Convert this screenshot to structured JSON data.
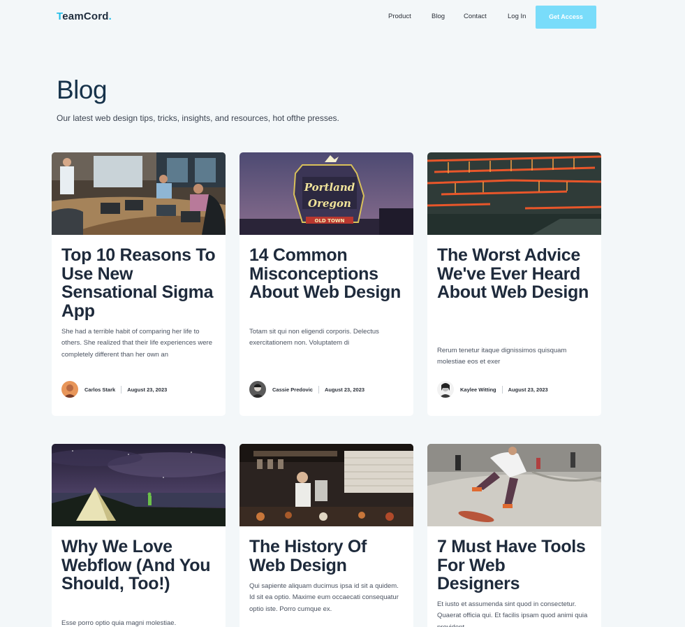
{
  "brand": {
    "first_letter": "T",
    "rest": "eamCord",
    "dot": "."
  },
  "nav": {
    "links": [
      "Product",
      "Blog",
      "Contact",
      "Log In"
    ],
    "cta": "Get Access"
  },
  "hero": {
    "title": "Blog",
    "subtitle": "Our latest web design tips, tricks, insights, and resources, hot ofthe presses."
  },
  "posts": [
    {
      "title": "Top 10 Reasons To Use New Sensational Sigma App",
      "excerpt": "She had a terrible habit of comparing her life to others. She realized that their life experiences were completely different than her own an",
      "author": "Carlos Stark",
      "date": "August 23, 2023"
    },
    {
      "title": "14 Common Misconceptions About Web Design",
      "excerpt": "Totam sit qui non eligendi corporis. Delectus exercitationem non. Voluptatem di",
      "author": "Cassie Predovic",
      "date": "August 23, 2023"
    },
    {
      "title": "The Worst Advice We've Ever Heard About Web Design",
      "excerpt": "Rerum tenetur itaque dignissimos quisquam molestiae eos et exer",
      "author": "Kaylee Witting",
      "date": "August 23, 2023"
    },
    {
      "title": "Why We Love Webflow (And You Should, Too!)",
      "excerpt": "Esse porro optio quia magni molestiae."
    },
    {
      "title": "The History Of Web Design",
      "excerpt": "Qui sapiente aliquam ducimus ipsa id sit a quidem. Id sit ea optio. Maxime eum occaecati consequatur optio iste. Porro cumque ex."
    },
    {
      "title": "7 Must Have Tools For Web Designers",
      "excerpt": "Et iusto et assumenda sint quod in consectetur. Quaerat officia qui. Et facilis ipsam quod animi quia provident"
    }
  ],
  "colors": {
    "background": "#f3f7f9",
    "accent": "#1fbde8",
    "cta": "#79dcfa",
    "heading": "#1e2a3b"
  }
}
